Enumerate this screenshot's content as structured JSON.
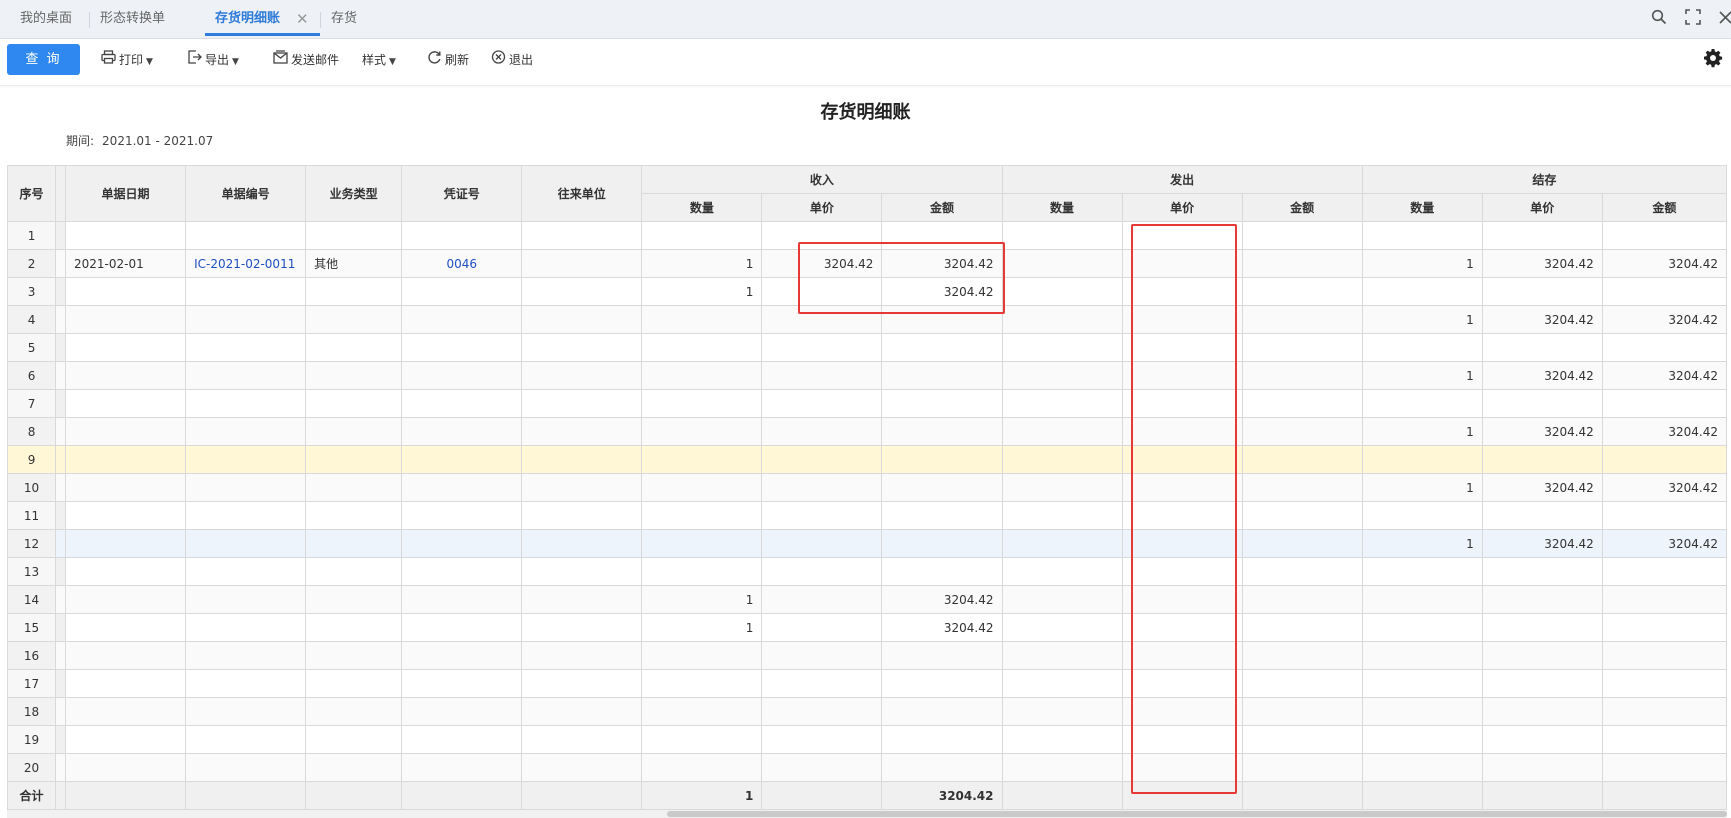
{
  "tabs": [
    {
      "label": "我的桌面",
      "active": false
    },
    {
      "label": "形态转换单",
      "active": false
    },
    {
      "label": "存货明细账",
      "active": true,
      "closable": true
    },
    {
      "label": "存货",
      "active": false
    }
  ],
  "top_icons": [
    "search-icon",
    "fullscreen-icon",
    "close-icon"
  ],
  "toolbar": {
    "query_label": "查 询",
    "print_label": "打印",
    "export_label": "导出",
    "email_label": "发送邮件",
    "style_label": "样式",
    "refresh_label": "刷新",
    "exit_label": "退出"
  },
  "report": {
    "title": "存货明细账",
    "period_label": "期间:",
    "period_value": "2021.01 - 2021.07"
  },
  "table": {
    "headers": {
      "seq": "序号",
      "date": "单据日期",
      "doc_no": "单据编号",
      "biz_type": "业务类型",
      "voucher": "凭证号",
      "partner": "往来单位",
      "income": "收入",
      "issue": "发出",
      "balance": "结存",
      "qty": "数量",
      "price": "单价",
      "amount": "金额"
    },
    "rows": [
      {
        "seq": "1"
      },
      {
        "seq": "2",
        "date": "2021-02-01",
        "doc_no": "IC-2021-02-0011",
        "biz_type": "其他",
        "voucher": "0046",
        "in_qty": "1",
        "in_price": "3204.42",
        "in_amt": "3204.42",
        "bal_qty": "1",
        "bal_price": "3204.42",
        "bal_amt": "3204.42"
      },
      {
        "seq": "3",
        "in_qty": "1",
        "in_amt": "3204.42"
      },
      {
        "seq": "4",
        "bal_qty": "1",
        "bal_price": "3204.42",
        "bal_amt": "3204.42"
      },
      {
        "seq": "5"
      },
      {
        "seq": "6",
        "bal_qty": "1",
        "bal_price": "3204.42",
        "bal_amt": "3204.42"
      },
      {
        "seq": "7"
      },
      {
        "seq": "8",
        "bal_qty": "1",
        "bal_price": "3204.42",
        "bal_amt": "3204.42"
      },
      {
        "seq": "9"
      },
      {
        "seq": "10",
        "bal_qty": "1",
        "bal_price": "3204.42",
        "bal_amt": "3204.42"
      },
      {
        "seq": "11"
      },
      {
        "seq": "12",
        "bal_qty": "1",
        "bal_price": "3204.42",
        "bal_amt": "3204.42"
      },
      {
        "seq": "13"
      },
      {
        "seq": "14",
        "in_qty": "1",
        "in_amt": "3204.42"
      },
      {
        "seq": "15",
        "in_qty": "1",
        "in_amt": "3204.42"
      },
      {
        "seq": "16"
      },
      {
        "seq": "17"
      },
      {
        "seq": "18"
      },
      {
        "seq": "19"
      },
      {
        "seq": "20"
      }
    ],
    "total": {
      "label": "合计",
      "in_qty": "1",
      "in_amt": "3204.42"
    }
  },
  "colors": {
    "accent": "#2f88f0",
    "annotation": "#e53935",
    "selected_row": "#fff7d6",
    "hover_row": "#eef4fc"
  }
}
